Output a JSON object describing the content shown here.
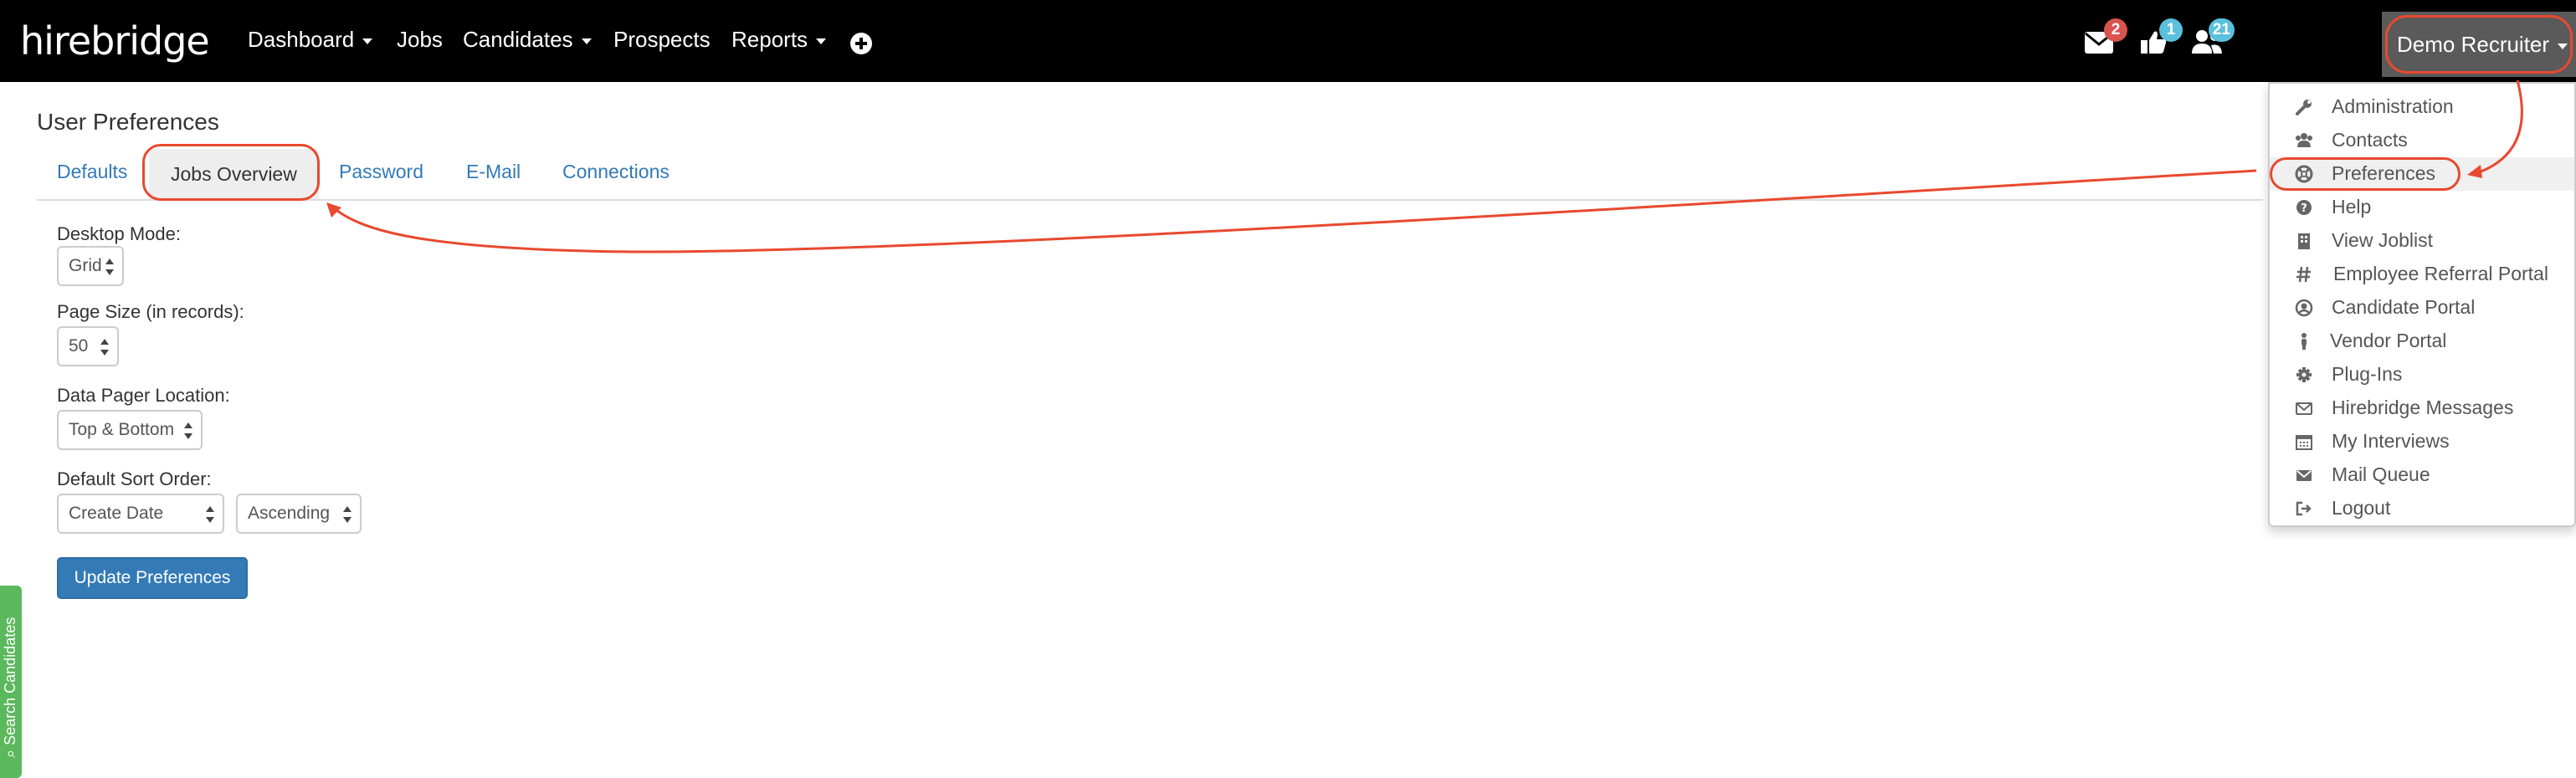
{
  "navbar": {
    "logo": "hirebridge",
    "items": [
      {
        "label": "Dashboard",
        "dropdown": true
      },
      {
        "label": "Jobs",
        "dropdown": false
      },
      {
        "label": "Candidates",
        "dropdown": true
      },
      {
        "label": "Prospects",
        "dropdown": false
      },
      {
        "label": "Reports",
        "dropdown": true
      }
    ],
    "badges": {
      "mail": "2",
      "thumbs": "1",
      "users": "21"
    },
    "badge_colors": {
      "mail": "#d9534f",
      "thumbs": "#5bc0de",
      "users": "#5bc0de"
    },
    "user_label": "Demo Recruiter"
  },
  "page": {
    "title": "User Preferences",
    "tabs": [
      "Defaults",
      "Jobs Overview",
      "Password",
      "E-Mail",
      "Connections"
    ],
    "active_tab": "Jobs Overview",
    "fields": {
      "desktop_mode": {
        "label": "Desktop Mode:",
        "value": "Grid"
      },
      "page_size": {
        "label": "Page Size (in records):",
        "value": "50"
      },
      "pager_location": {
        "label": "Data Pager Location:",
        "value": "Top & Bottom"
      },
      "sort_order": {
        "label": "Default Sort Order:",
        "field_value": "Create Date",
        "direction_value": "Ascending"
      }
    },
    "update_button": "Update Preferences",
    "side_tab": "Search Candidates"
  },
  "menu": {
    "items": [
      {
        "label": "Administration",
        "icon": "wrench-icon"
      },
      {
        "label": "Contacts",
        "icon": "users-icon"
      },
      {
        "label": "Preferences",
        "icon": "life-ring-icon"
      },
      {
        "label": "Help",
        "icon": "question-circle-icon"
      },
      {
        "label": "View Joblist",
        "icon": "building-icon"
      },
      {
        "label": "Employee Referral Portal",
        "icon": "hashtag-icon"
      },
      {
        "label": "Candidate Portal",
        "icon": "user-circle-icon"
      },
      {
        "label": "Vendor Portal",
        "icon": "person-icon"
      },
      {
        "label": "Plug-Ins",
        "icon": "gear-icon"
      },
      {
        "label": "Hirebridge Messages",
        "icon": "envelope-outline-icon"
      },
      {
        "label": "My Interviews",
        "icon": "calendar-icon"
      },
      {
        "label": "Mail Queue",
        "icon": "envelope-icon"
      },
      {
        "label": "Logout",
        "icon": "sign-out-icon"
      }
    ],
    "highlighted": "Preferences"
  },
  "colors": {
    "accent": "#337ab7",
    "annotation": "#e8492f",
    "navbar": "#000000",
    "side_tab": "#5cb85c"
  }
}
